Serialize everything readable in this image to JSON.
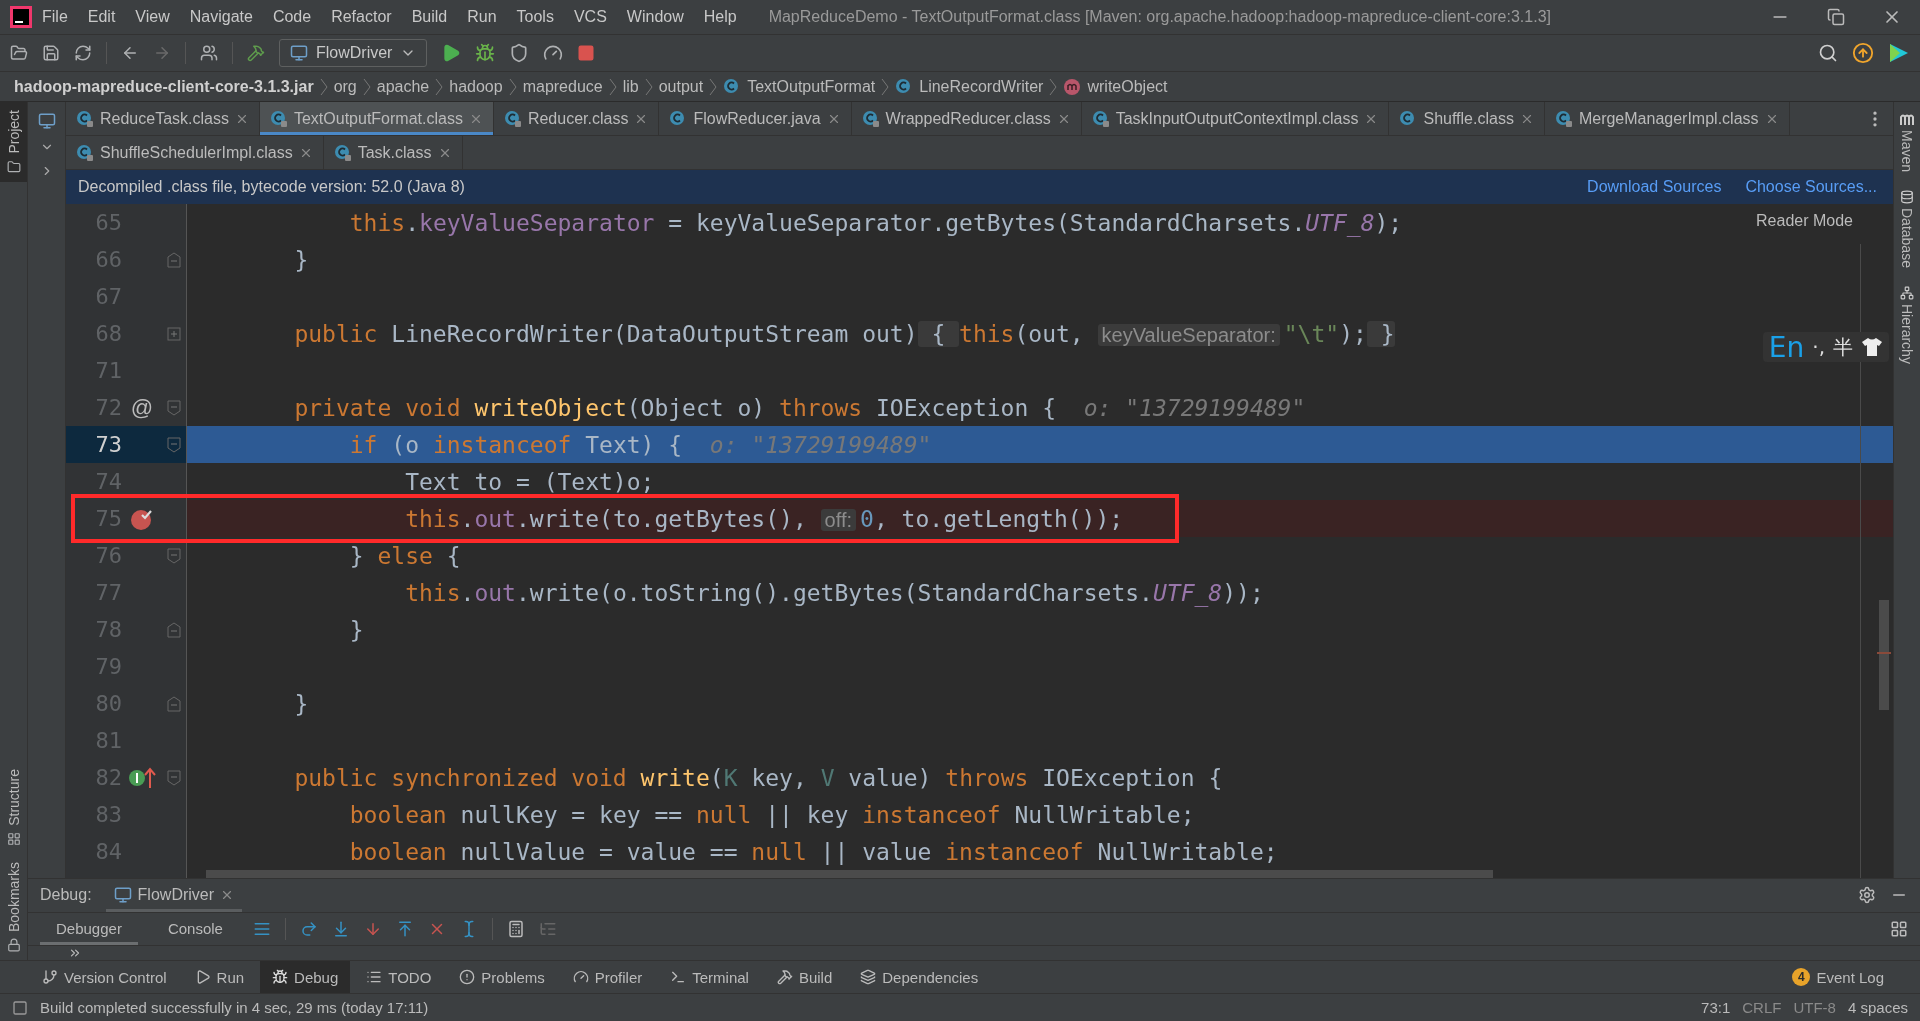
{
  "window": {
    "title": "MapReduceDemo - TextOutputFormat.class [Maven: org.apache.hadoop:hadoop-mapreduce-client-core:3.1.3]"
  },
  "menu": [
    "File",
    "Edit",
    "View",
    "Navigate",
    "Code",
    "Refactor",
    "Build",
    "Run",
    "Tools",
    "VCS",
    "Window",
    "Help"
  ],
  "toolbar": {
    "run_configuration": "FlowDriver"
  },
  "breadcrumbs": [
    {
      "kind": "jar",
      "label": "hadoop-mapreduce-client-core-3.1.3.jar"
    },
    {
      "kind": "package",
      "label": "org"
    },
    {
      "kind": "package",
      "label": "apache"
    },
    {
      "kind": "package",
      "label": "hadoop"
    },
    {
      "kind": "package",
      "label": "mapreduce"
    },
    {
      "kind": "package",
      "label": "lib"
    },
    {
      "kind": "package",
      "label": "output"
    },
    {
      "kind": "class",
      "label": "TextOutputFormat"
    },
    {
      "kind": "class",
      "label": "LineRecordWriter"
    },
    {
      "kind": "method",
      "label": "writeObject"
    }
  ],
  "left_tool_strip": [
    {
      "label": "Project",
      "selected": true
    },
    {
      "label": "Structure",
      "selected": false
    },
    {
      "label": "Bookmarks",
      "selected": false
    }
  ],
  "right_tool_strip": [
    {
      "label": "Maven",
      "kind": "maven"
    },
    {
      "label": "Database",
      "kind": "database"
    },
    {
      "label": "Hierarchy",
      "kind": "hierarchy"
    }
  ],
  "tab_rows": [
    [
      {
        "label": "ReduceTask.class",
        "selected": false,
        "locked": true
      },
      {
        "label": "TextOutputFormat.class",
        "selected": true,
        "locked": true
      },
      {
        "label": "Reducer.class",
        "selected": false,
        "locked": true
      },
      {
        "label": "FlowReducer.java",
        "selected": false,
        "locked": false
      },
      {
        "label": "WrappedReducer.class",
        "selected": false,
        "locked": true
      },
      {
        "label": "TaskInputOutputContextImpl.class",
        "selected": false,
        "locked": true
      },
      {
        "label": "Shuffle.class",
        "selected": false,
        "locked": false
      },
      {
        "label": "MergeManagerImpl.class",
        "selected": false,
        "locked": true
      }
    ],
    [
      {
        "label": "ShuffleSchedulerImpl.class",
        "selected": false,
        "locked": true
      },
      {
        "label": "Task.class",
        "selected": false,
        "locked": true
      }
    ]
  ],
  "banner": {
    "text": "Decompiled .class file, bytecode version: 52.0 (Java 8)",
    "links": [
      "Download Sources",
      "Choose Sources..."
    ]
  },
  "editor": {
    "reader_mode": "Reader Mode",
    "lines": [
      {
        "number": "65",
        "selected": false,
        "breakpoint": false,
        "tokens": [
          {
            "kind": "kw",
            "text": "        this"
          },
          {
            "kind": "plain",
            "text": "."
          },
          {
            "kind": "field",
            "text": "keyValueSeparator"
          },
          {
            "kind": "plain",
            "text": " = keyValueSeparator.getBytes(StandardCharsets."
          },
          {
            "kind": "static",
            "text": "UTF_8"
          },
          {
            "kind": "plain",
            "text": ");"
          }
        ]
      },
      {
        "number": "66",
        "selected": false,
        "breakpoint": false,
        "fold_end": true,
        "tokens": [
          {
            "kind": "plain",
            "text": "    }"
          }
        ]
      },
      {
        "number": "67",
        "selected": false,
        "breakpoint": false
      },
      {
        "number": "68",
        "selected": false,
        "breakpoint": false,
        "folded": true,
        "tokens": [
          {
            "kind": "kw",
            "text": "    public "
          },
          {
            "kind": "plain",
            "text": "LineRecordWriter(DataOutputStream out)"
          },
          {
            "kind": "fold",
            "text": " { "
          },
          {
            "kind": "kw",
            "text": "this"
          },
          {
            "kind": "plain",
            "text": "(out, "
          },
          {
            "kind": "hint",
            "text": "keyValueSeparator:"
          },
          {
            "kind": "str",
            "text": "\"\\t\""
          },
          {
            "kind": "plain",
            "text": ");"
          },
          {
            "kind": "fold",
            "text": " }"
          }
        ]
      },
      {
        "number": "71",
        "selected": false,
        "breakpoint": false
      },
      {
        "number": "72",
        "selected": false,
        "breakpoint": false,
        "fold_start": true,
        "gutter_text": "@",
        "tokens": [
          {
            "kind": "kw",
            "text": "    private void "
          },
          {
            "kind": "fn",
            "text": "writeObject"
          },
          {
            "kind": "plain",
            "text": "(Object o) "
          },
          {
            "kind": "kw",
            "text": "throws "
          },
          {
            "kind": "plain",
            "text": "IOException {"
          },
          {
            "kind": "value",
            "text": "  o: \"13729199489\""
          }
        ]
      },
      {
        "number": "73",
        "selected": true,
        "breakpoint": false,
        "fold_start": true,
        "tokens": [
          {
            "kind": "kw",
            "text": "        if "
          },
          {
            "kind": "plain",
            "text": "(o "
          },
          {
            "kind": "kw",
            "text": "instanceof "
          },
          {
            "kind": "plain",
            "text": "Text) {"
          },
          {
            "kind": "value",
            "text": "  o: \"13729199489\""
          }
        ]
      },
      {
        "number": "74",
        "selected": false,
        "breakpoint": false,
        "tokens": [
          {
            "kind": "plain",
            "text": "            Text to = (Text)o;"
          }
        ]
      },
      {
        "number": "75",
        "selected": false,
        "breakpoint": true,
        "annotated": true,
        "tokens": [
          {
            "kind": "kw",
            "text": "            this"
          },
          {
            "kind": "plain",
            "text": "."
          },
          {
            "kind": "field",
            "text": "out"
          },
          {
            "kind": "plain",
            "text": ".write(to.getBytes(), "
          },
          {
            "kind": "hint",
            "text": "off:"
          },
          {
            "kind": "num",
            "text": "0"
          },
          {
            "kind": "plain",
            "text": ", to.getLength());"
          }
        ]
      },
      {
        "number": "76",
        "selected": false,
        "breakpoint": false,
        "fold_start": true,
        "tokens": [
          {
            "kind": "plain",
            "text": "        } "
          },
          {
            "kind": "kw",
            "text": "else"
          },
          {
            "kind": "plain",
            "text": " {"
          }
        ]
      },
      {
        "number": "77",
        "selected": false,
        "breakpoint": false,
        "tokens": [
          {
            "kind": "kw",
            "text": "            this"
          },
          {
            "kind": "plain",
            "text": "."
          },
          {
            "kind": "field",
            "text": "out"
          },
          {
            "kind": "plain",
            "text": ".write(o.toString().getBytes(StandardCharsets."
          },
          {
            "kind": "static",
            "text": "UTF_8"
          },
          {
            "kind": "plain",
            "text": "));"
          }
        ]
      },
      {
        "number": "78",
        "selected": false,
        "breakpoint": false,
        "fold_end": true,
        "tokens": [
          {
            "kind": "plain",
            "text": "        }"
          }
        ]
      },
      {
        "number": "79",
        "selected": false,
        "breakpoint": false
      },
      {
        "number": "80",
        "selected": false,
        "breakpoint": false,
        "fold_end": true,
        "tokens": [
          {
            "kind": "plain",
            "text": "    }"
          }
        ]
      },
      {
        "number": "81",
        "selected": false,
        "breakpoint": false
      },
      {
        "number": "82",
        "selected": false,
        "breakpoint": false,
        "fold_start": true,
        "implements": true,
        "tokens": [
          {
            "kind": "kw",
            "text": "    public synchronized void "
          },
          {
            "kind": "fn",
            "text": "write"
          },
          {
            "kind": "plain",
            "text": "("
          },
          {
            "kind": "type",
            "text": "K"
          },
          {
            "kind": "plain",
            "text": " key, "
          },
          {
            "kind": "type",
            "text": "V"
          },
          {
            "kind": "plain",
            "text": " value) "
          },
          {
            "kind": "kw",
            "text": "throws "
          },
          {
            "kind": "plain",
            "text": "IOException {"
          }
        ]
      },
      {
        "number": "83",
        "selected": false,
        "breakpoint": false,
        "tokens": [
          {
            "kind": "kw",
            "text": "        boolean "
          },
          {
            "kind": "plain",
            "text": "nullKey = key == "
          },
          {
            "kind": "kw",
            "text": "null "
          },
          {
            "kind": "plain",
            "text": "|| key "
          },
          {
            "kind": "kw",
            "text": "instanceof "
          },
          {
            "kind": "plain",
            "text": "NullWritable;"
          }
        ]
      },
      {
        "number": "84",
        "selected": false,
        "breakpoint": false,
        "tokens": [
          {
            "kind": "kw",
            "text": "        boolean "
          },
          {
            "kind": "plain",
            "text": "nullValue = value == "
          },
          {
            "kind": "kw",
            "text": "null "
          },
          {
            "kind": "plain",
            "text": "|| value "
          },
          {
            "kind": "kw",
            "text": "instanceof "
          },
          {
            "kind": "plain",
            "text": "NullWritable;"
          }
        ]
      }
    ]
  },
  "ime": [
    "En",
    "·,",
    "半"
  ],
  "debug": {
    "label": "Debug:",
    "session": "FlowDriver",
    "tabs": [
      {
        "label": "Debugger",
        "selected": true
      },
      {
        "label": "Console",
        "selected": false
      }
    ]
  },
  "tool_windows": [
    {
      "label": "Version Control",
      "kind": "vcs",
      "selected": false
    },
    {
      "label": "Run",
      "kind": "run",
      "selected": false
    },
    {
      "label": "Debug",
      "kind": "debug",
      "selected": true
    },
    {
      "label": "TODO",
      "kind": "todo",
      "selected": false
    },
    {
      "label": "Problems",
      "kind": "problems",
      "selected": false
    },
    {
      "label": "Profiler",
      "kind": "profiler",
      "selected": false
    },
    {
      "label": "Terminal",
      "kind": "terminal",
      "selected": false
    },
    {
      "label": "Build",
      "kind": "build",
      "selected": false
    },
    {
      "label": "Dependencies",
      "kind": "dependencies",
      "selected": false
    }
  ],
  "event_log": {
    "label": "Event Log",
    "count": "4"
  },
  "status_bar": {
    "message": "Build completed successfully in 4 sec, 29 ms (today 17:11)",
    "items": [
      "73:1",
      "CRLF",
      "UTF-8",
      "4 spaces"
    ]
  }
}
